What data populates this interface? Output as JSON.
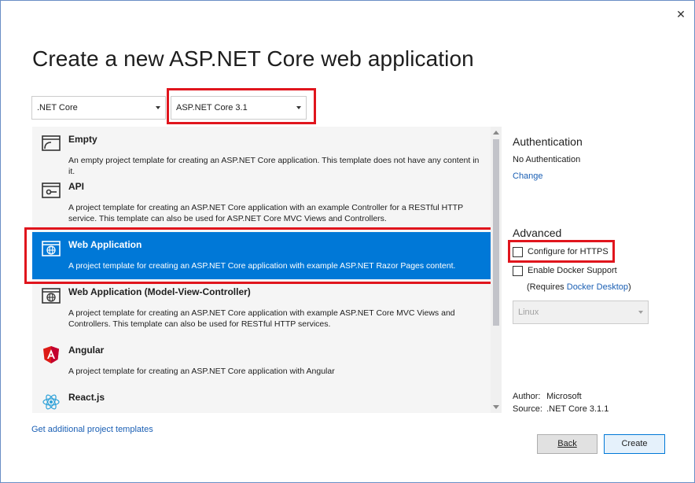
{
  "dialog": {
    "title": "Create a new ASP.NET Core web application",
    "close_glyph": "✕"
  },
  "framework_dropdown": {
    "value": ".NET Core"
  },
  "version_dropdown": {
    "value": "ASP.NET Core 3.1"
  },
  "templates": [
    {
      "name": "Empty",
      "description": "An empty project template for creating an ASP.NET Core application. This template does not have any content in it.",
      "icon": "empty-template-icon",
      "selected": false
    },
    {
      "name": "API",
      "description": "A project template for creating an ASP.NET Core application with an example Controller for a RESTful HTTP service. This template can also be used for ASP.NET Core MVC Views and Controllers.",
      "icon": "api-template-icon",
      "selected": false
    },
    {
      "name": "Web Application",
      "description": "A project template for creating an ASP.NET Core application with example ASP.NET Razor Pages content.",
      "icon": "web-app-globe-icon",
      "selected": true
    },
    {
      "name": "Web Application (Model-View-Controller)",
      "description": "A project template for creating an ASP.NET Core application with example ASP.NET Core MVC Views and Controllers. This template can also be used for RESTful HTTP services.",
      "icon": "mvc-globe-icon",
      "selected": false
    },
    {
      "name": "Angular",
      "description": "A project template for creating an ASP.NET Core application with Angular",
      "icon": "angular-icon",
      "selected": false
    },
    {
      "name": "React.js",
      "description": "",
      "icon": "react-icon",
      "selected": false
    }
  ],
  "get_more_link": "Get additional project templates",
  "authentication": {
    "heading": "Authentication",
    "value": "No Authentication",
    "change_link": "Change"
  },
  "advanced": {
    "heading": "Advanced",
    "https_label": "Configure for HTTPS",
    "https_checked": false,
    "docker_label": "Enable Docker Support",
    "docker_checked": false,
    "requires_prefix": "(Requires ",
    "requires_link": "Docker Desktop",
    "requires_suffix": ")",
    "os_value": "Linux"
  },
  "meta": {
    "author_label": "Author:",
    "author_value": "Microsoft",
    "source_label": "Source:",
    "source_value": ".NET Core 3.1.1"
  },
  "buttons": {
    "back": "Back",
    "create": "Create"
  },
  "colors": {
    "accent": "#0078d7",
    "highlight_box": "#e0151d",
    "link": "#1a5fb4"
  }
}
